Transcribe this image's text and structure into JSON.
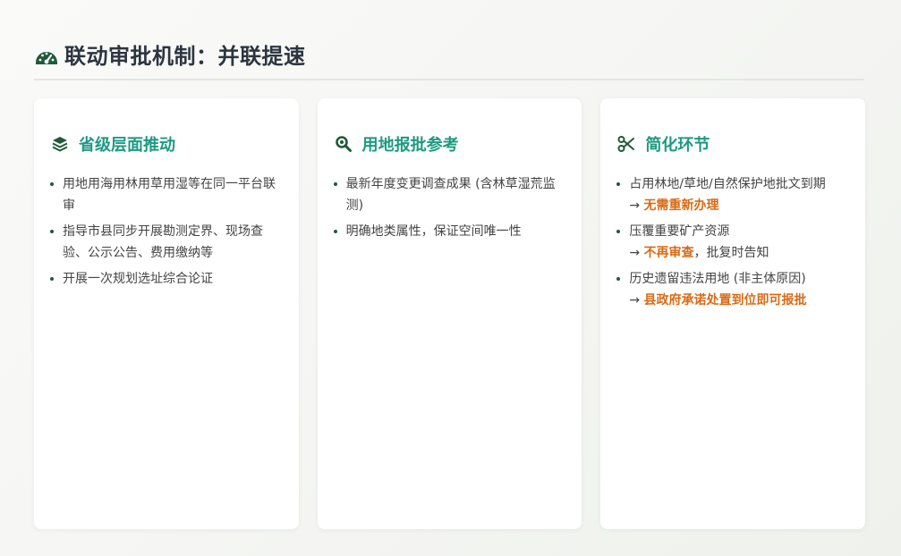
{
  "header": {
    "title": "联动审批机制：并联提速",
    "icon": "speedometer-icon"
  },
  "colors": {
    "accent": "#1e9a82",
    "icon_dark": "#1f5a3a",
    "highlight": "#d96a14",
    "title": "#2c3540"
  },
  "cards": [
    {
      "icon": "layers-icon",
      "title": "省级层面推动",
      "items": [
        "用地用海用林用草用湿等在同一平台联审",
        "指导市县同步开展勘测定界、现场查验、公示公告、费用缴纳等",
        "开展一次规划选址综合论证"
      ]
    },
    {
      "icon": "magnifier-icon",
      "title": "用地报批参考",
      "items": [
        "最新年度变更调查成果 (含林草湿荒监测)",
        "明确地类属性，保证空间唯一性"
      ]
    },
    {
      "icon": "scissors-icon",
      "title": "简化环节",
      "items": [
        {
          "text": "占用林地/草地/自然保护地批文到期",
          "arrow": "→",
          "highlight": "无需重新办理",
          "suffix": ""
        },
        {
          "text": "压覆重要矿产资源",
          "arrow": "→",
          "highlight": "不再审查",
          "suffix": "，批复时告知"
        },
        {
          "text": "历史遗留违法用地 (非主体原因)",
          "arrow": "→",
          "highlight": "县政府承诺处置到位即可报批",
          "suffix": ""
        }
      ]
    }
  ]
}
